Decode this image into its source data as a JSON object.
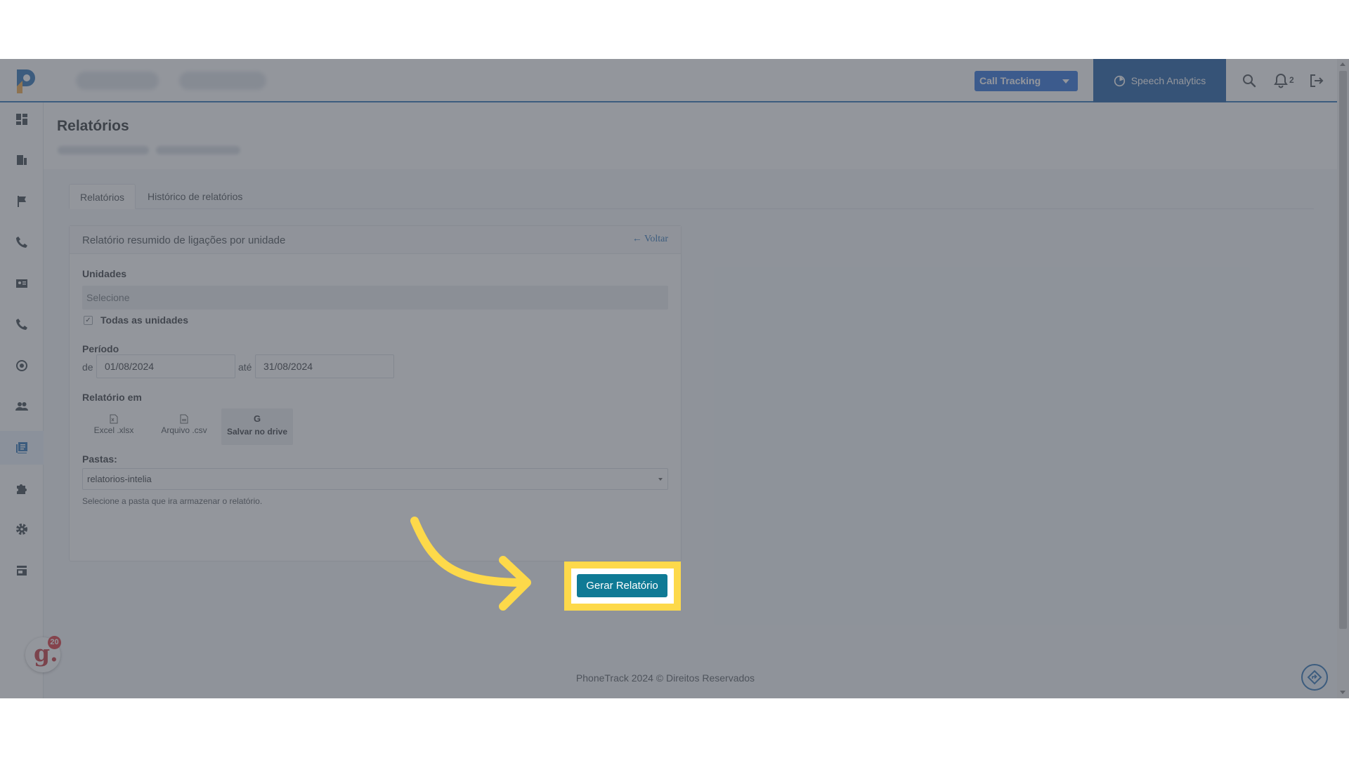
{
  "header": {
    "product_select": "Call Tracking",
    "speech_analytics": "Speech Analytics",
    "notifications_count": "2"
  },
  "page": {
    "title": "Relatórios"
  },
  "tabs": [
    {
      "label": "Relatórios",
      "active": true
    },
    {
      "label": "Histórico de relatórios",
      "active": false
    }
  ],
  "card": {
    "title": "Relatório resumido de ligações por unidade",
    "back_label": "Voltar",
    "units_label": "Unidades",
    "units_placeholder": "Selecione",
    "all_units_label": "Todas as unidades",
    "all_units_checked": true,
    "period_label": "Período",
    "from_label": "de",
    "start_date": "01/08/2024",
    "to_label": "até",
    "end_date": "31/08/2024",
    "report_in_label": "Relatório em",
    "formats": [
      {
        "label": "Excel .xlsx",
        "icon": "file-icon",
        "active": false
      },
      {
        "label": "Arquivo .csv",
        "icon": "file-icon",
        "active": false
      },
      {
        "label": "Salvar no drive",
        "icon": "google-icon",
        "active": true
      }
    ],
    "folders_label": "Pastas:",
    "folder_value": "relatorios-intelia",
    "folder_help": "Selecione a pasta que ira armazenar o relatório.",
    "generate_button": "Gerar Relatório"
  },
  "footer": {
    "copyright": "PhoneTrack 2024 © Direitos Reservados"
  },
  "chat": {
    "badge": "20",
    "logo": "g."
  },
  "sidebar": {
    "items": [
      {
        "icon": "dashboard-icon"
      },
      {
        "icon": "building-icon"
      },
      {
        "icon": "flag-icon"
      },
      {
        "icon": "phone-icon"
      },
      {
        "icon": "contact-card-icon"
      },
      {
        "icon": "phone-icon"
      },
      {
        "icon": "speech-analytics-icon"
      },
      {
        "icon": "users-icon"
      },
      {
        "icon": "reports-icon",
        "active": true
      },
      {
        "icon": "puzzle-icon"
      },
      {
        "icon": "gear-icon"
      },
      {
        "icon": "store-icon"
      }
    ]
  },
  "colors": {
    "brand": "#1b67b0",
    "speech_bg": "#0c4f9e",
    "button": "#0f7a95",
    "highlight": "#fdd94a"
  }
}
